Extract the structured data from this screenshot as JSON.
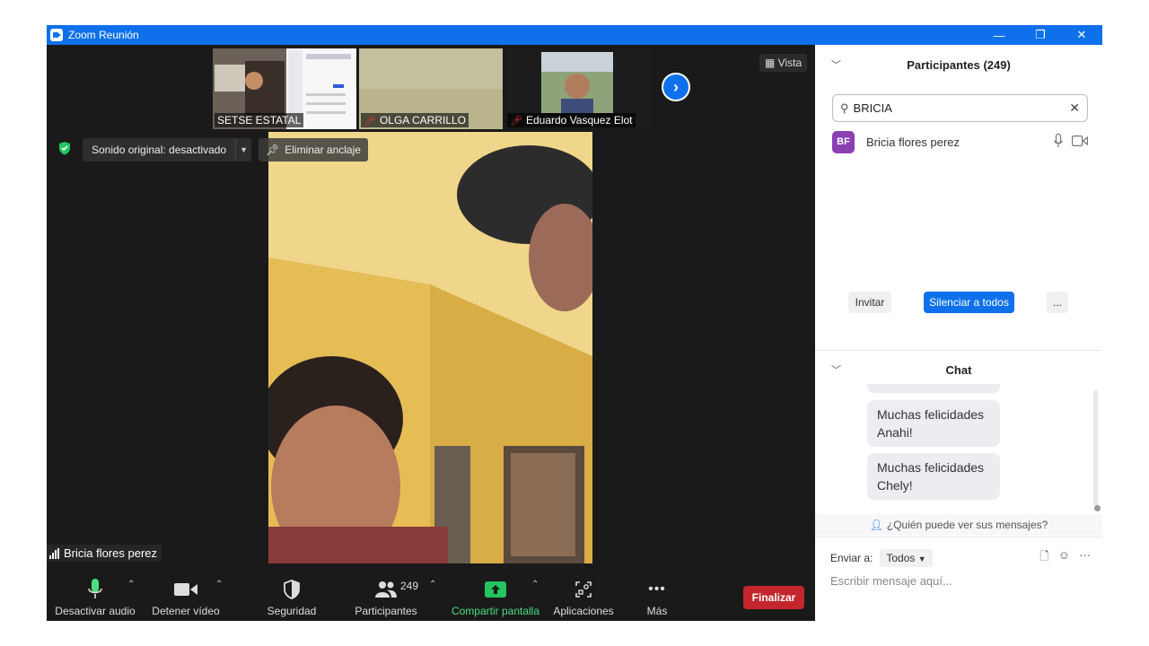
{
  "window": {
    "title": "Zoom Reunión",
    "controls": {
      "minimize": "—",
      "restore": "❐",
      "close": "✕"
    }
  },
  "thumbnails": [
    {
      "name": "SETSE ESTATAL",
      "muted": false
    },
    {
      "name": "OLGA CARRILLO",
      "muted": true
    },
    {
      "name": "Eduardo Vasquez Elot",
      "muted": true
    }
  ],
  "view_button": {
    "label": "Vista",
    "icon": "grid-icon"
  },
  "sound_option": {
    "label": "Sonido original: desactivado"
  },
  "unpin": {
    "label": "Eliminar anclaje"
  },
  "active_speaker": {
    "name": "Bricia flores perez"
  },
  "toolbar": {
    "audio_label": "Desactivar audio",
    "video_label": "Detener vídeo",
    "security_label": "Seguridad",
    "participants_label": "Participantes",
    "participants_count": "249",
    "share_label": "Compartir pantalla",
    "apps_label": "Aplicaciones",
    "more_label": "Más",
    "end_label": "Finalizar"
  },
  "participants_panel": {
    "title": "Participantes (249)",
    "search_value": "BRICIA",
    "results": [
      {
        "initials": "BF",
        "name": "Bricia flores perez",
        "avatar_color": "#8b3fb3"
      }
    ],
    "invite_label": "Invitar",
    "mute_all_label": "Silenciar a todos",
    "more_label": "..."
  },
  "chat": {
    "title": "Chat",
    "messages": [
      {
        "line1": "Muchas felicidades",
        "line2": "Anahi!"
      },
      {
        "line1": "Muchas felicidades",
        "line2": "Chely!"
      }
    ],
    "who_sees": "¿Quién puede ver sus mensajes?",
    "send_to_label": "Enviar a:",
    "send_to_value": "Todos",
    "input_placeholder": "Escribir mensaje aquí..."
  },
  "colors": {
    "accent_blue": "#0e71eb",
    "end_red": "#c4262e",
    "share_green": "#22c55e",
    "mic_green": "#4ade80"
  }
}
